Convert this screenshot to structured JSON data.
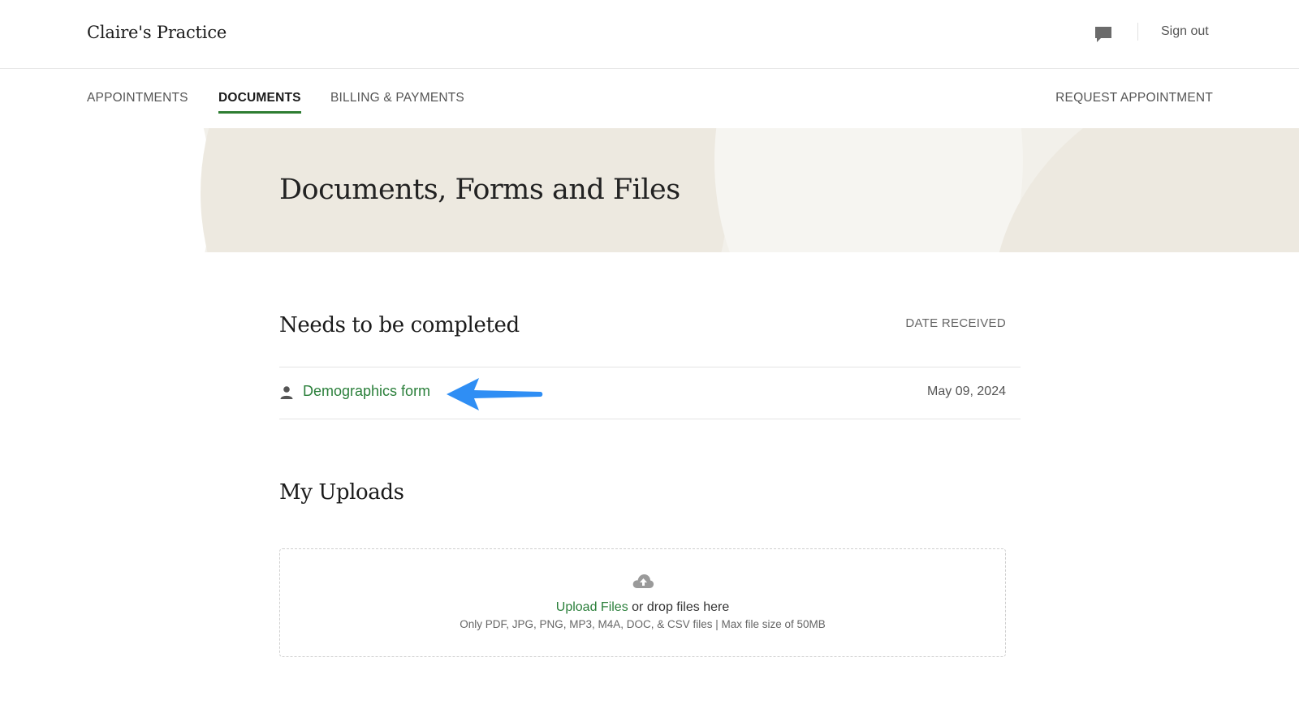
{
  "header": {
    "practice_name": "Claire's Practice",
    "chat_icon": "chat-bubble-icon",
    "sign_out_label": "Sign out"
  },
  "nav": {
    "tabs": [
      {
        "label": "APPOINTMENTS",
        "active": false
      },
      {
        "label": "DOCUMENTS",
        "active": true
      },
      {
        "label": "BILLING & PAYMENTS",
        "active": false
      }
    ],
    "request_appointment_label": "REQUEST APPOINTMENT"
  },
  "hero": {
    "title": "Documents, Forms and Files"
  },
  "needs_completed": {
    "heading": "Needs to be completed",
    "date_column_label": "DATE RECEIVED",
    "items": [
      {
        "icon": "person-icon",
        "name": "Demographics form",
        "date": "May 09, 2024"
      }
    ]
  },
  "uploads": {
    "heading": "My Uploads",
    "icon": "cloud-upload-icon",
    "upload_link_label": "Upload Files",
    "drop_text": " or drop files here",
    "hint": "Only PDF, JPG, PNG, MP3, M4A, DOC, & CSV files | Max file size of 50MB"
  },
  "colors": {
    "accent_green": "#2a7f3a",
    "hero_background": "#f2f0ea",
    "annotation_arrow": "#2f8ef4"
  }
}
